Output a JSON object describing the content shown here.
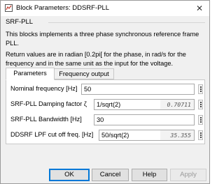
{
  "window": {
    "title": "Block Parameters: DDSRF-PLL",
    "close_glyph": "✕"
  },
  "block": {
    "name": "SRF-PLL",
    "description_1": "This blocks implements a three phase synchronous reference frame PLL.",
    "description_2": "Return values are in radian [0.2pi[ for the phase, in rad/s for the frequency and in the same unit as the input for the voltage."
  },
  "tabs": [
    {
      "label": "Parameters",
      "active": true
    },
    {
      "label": "Frequency output",
      "active": false
    }
  ],
  "params": [
    {
      "label": "Nominal frequency [Hz]",
      "value": "50",
      "evaluated": ""
    },
    {
      "label": "SRF-PLL Damping factor ζ",
      "value": "1/sqrt(2)",
      "evaluated": "0.70711"
    },
    {
      "label": "SRF-PLL Bandwidth [Hz]",
      "value": "30",
      "evaluated": ""
    },
    {
      "label": "DDSRF LPF cut off freq. [Hz]",
      "value": "50/sqrt(2)",
      "evaluated": "35.355"
    }
  ],
  "buttons": {
    "ok": "OK",
    "cancel": "Cancel",
    "help": "Help",
    "apply": "Apply"
  },
  "colors": {
    "accent": "#0078d7",
    "dialog_bg": "#f0f0f0",
    "panel_bg": "#ffffff"
  }
}
